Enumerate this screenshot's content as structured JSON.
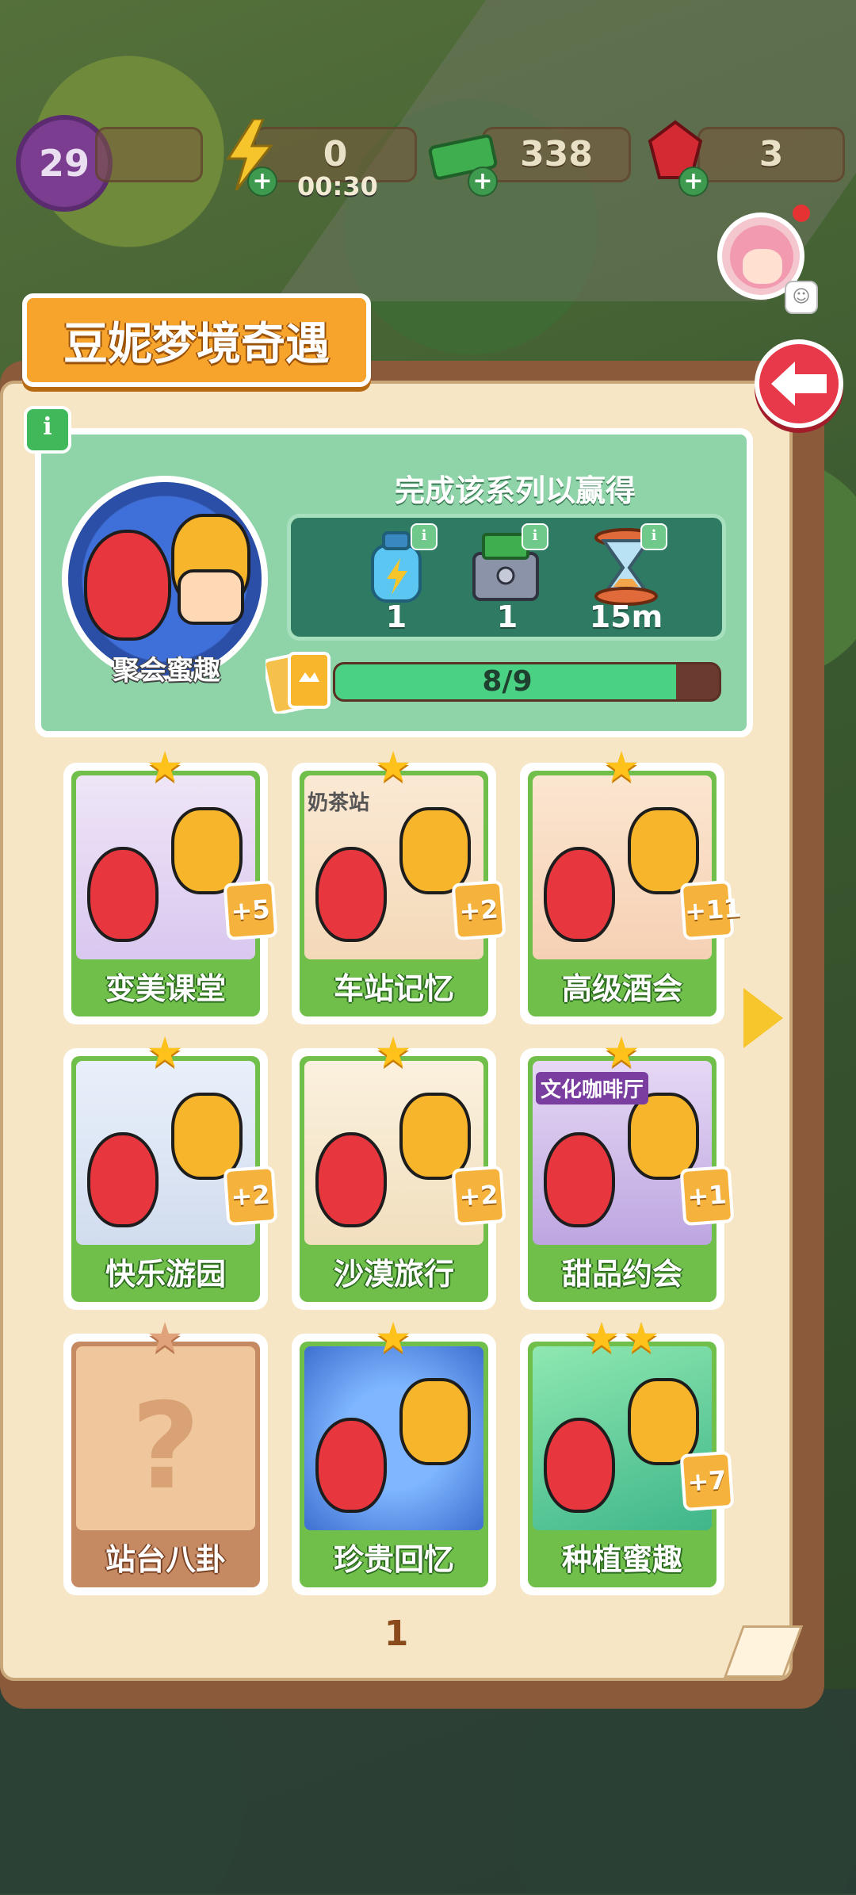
{
  "hud": {
    "level": "29",
    "energy": "0",
    "energy_timer": "00:30",
    "cash": "338",
    "gems": "3"
  },
  "panel": {
    "title": "豆妮梦境奇遇",
    "complete_text": "完成该系列以赢得",
    "series_name": "聚会蜜趣",
    "progress_text": "8/9",
    "progress_fraction": 0.889,
    "rewards": [
      {
        "icon": "energy-bottle-icon",
        "qty": "1"
      },
      {
        "icon": "cash-chest-icon",
        "qty": "1"
      },
      {
        "icon": "hourglass-icon",
        "qty": "15m"
      }
    ],
    "page_number": "1"
  },
  "cards": [
    {
      "label": "变美课堂",
      "badge": "+5",
      "locked": false,
      "stars": 1
    },
    {
      "label": "车站记忆",
      "badge": "+2",
      "locked": false,
      "stars": 1
    },
    {
      "label": "高级酒会",
      "badge": "+11",
      "locked": false,
      "stars": 1
    },
    {
      "label": "快乐游园",
      "badge": "+2",
      "locked": false,
      "stars": 1
    },
    {
      "label": "沙漠旅行",
      "badge": "+2",
      "locked": false,
      "stars": 1
    },
    {
      "label": "甜品约会",
      "badge": "+1",
      "locked": false,
      "stars": 1
    },
    {
      "label": "站台八卦",
      "badge": "",
      "locked": true,
      "stars": 1
    },
    {
      "label": "珍贵回忆",
      "badge": "",
      "locked": false,
      "stars": 1
    },
    {
      "label": "种植蜜趣",
      "badge": "+7",
      "locked": false,
      "stars": 2
    }
  ],
  "art_text": {
    "tea_station": "奶茶站",
    "cafe": "文化咖啡厅"
  },
  "colors": {
    "title_tab": "#f7a42c",
    "card_green": "#6fbf4a",
    "back_button": "#e8394a",
    "progress_fill": "#4bd184"
  }
}
